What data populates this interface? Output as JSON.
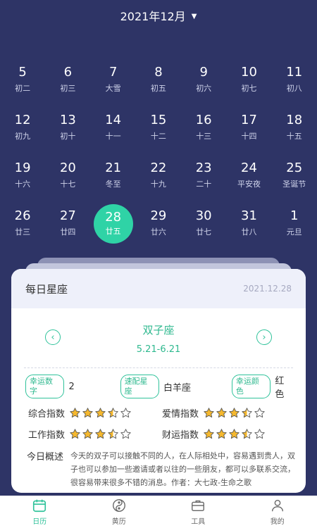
{
  "header": {
    "month": "2021年12月",
    "caret": "▼"
  },
  "calendar": {
    "rows": [
      [
        {
          "day": "5",
          "sub": "初二"
        },
        {
          "day": "6",
          "sub": "初三"
        },
        {
          "day": "7",
          "sub": "大雪"
        },
        {
          "day": "8",
          "sub": "初五"
        },
        {
          "day": "9",
          "sub": "初六"
        },
        {
          "day": "10",
          "sub": "初七"
        },
        {
          "day": "11",
          "sub": "初八"
        }
      ],
      [
        {
          "day": "12",
          "sub": "初九"
        },
        {
          "day": "13",
          "sub": "初十"
        },
        {
          "day": "14",
          "sub": "十一"
        },
        {
          "day": "15",
          "sub": "十二"
        },
        {
          "day": "16",
          "sub": "十三"
        },
        {
          "day": "17",
          "sub": "十四"
        },
        {
          "day": "18",
          "sub": "十五"
        }
      ],
      [
        {
          "day": "19",
          "sub": "十六"
        },
        {
          "day": "20",
          "sub": "十七"
        },
        {
          "day": "21",
          "sub": "冬至"
        },
        {
          "day": "22",
          "sub": "十九"
        },
        {
          "day": "23",
          "sub": "二十"
        },
        {
          "day": "24",
          "sub": "平安夜"
        },
        {
          "day": "25",
          "sub": "圣诞节"
        }
      ],
      [
        {
          "day": "26",
          "sub": "廿三"
        },
        {
          "day": "27",
          "sub": "廿四"
        },
        {
          "day": "28",
          "sub": "廿五",
          "selected": true
        },
        {
          "day": "29",
          "sub": "廿六"
        },
        {
          "day": "30",
          "sub": "廿七"
        },
        {
          "day": "31",
          "sub": "廿八"
        },
        {
          "day": "1",
          "sub": "元旦"
        }
      ]
    ]
  },
  "horoscope": {
    "title": "每日星座",
    "date": "2021.12.28",
    "prev": "‹",
    "next": "›",
    "sign": "双子座",
    "range": "5.21-6.21",
    "lucky_number_label": "幸运数字",
    "lucky_number": "2",
    "match_label": "速配星座",
    "match": "白羊座",
    "lucky_color_label": "幸运颜色",
    "lucky_color": "红色",
    "indices": [
      {
        "label": "综合指数",
        "stars": 3.5
      },
      {
        "label": "爱情指数",
        "stars": 3.5
      },
      {
        "label": "工作指数",
        "stars": 3.5
      },
      {
        "label": "财运指数",
        "stars": 3.5
      }
    ],
    "overview_label": "今日概述",
    "overview_text": "今天的双子可以接触不同的人，在人际相处中，容易遇到贵人，双子也可以参加一些邀请或者以往的一些朋友，都可以多联系交流，很容易带来很多不错的消息。作者：大七政-生命之歌"
  },
  "tabs": [
    {
      "label": "日历",
      "icon": "calendar-icon",
      "active": true
    },
    {
      "label": "黄历",
      "icon": "yin-yang-icon"
    },
    {
      "label": "工具",
      "icon": "briefcase-icon"
    },
    {
      "label": "我的",
      "icon": "user-icon"
    }
  ],
  "colors": {
    "background": "#2e3466",
    "accent": "#2fd3a6",
    "star": "#f5b82e"
  }
}
